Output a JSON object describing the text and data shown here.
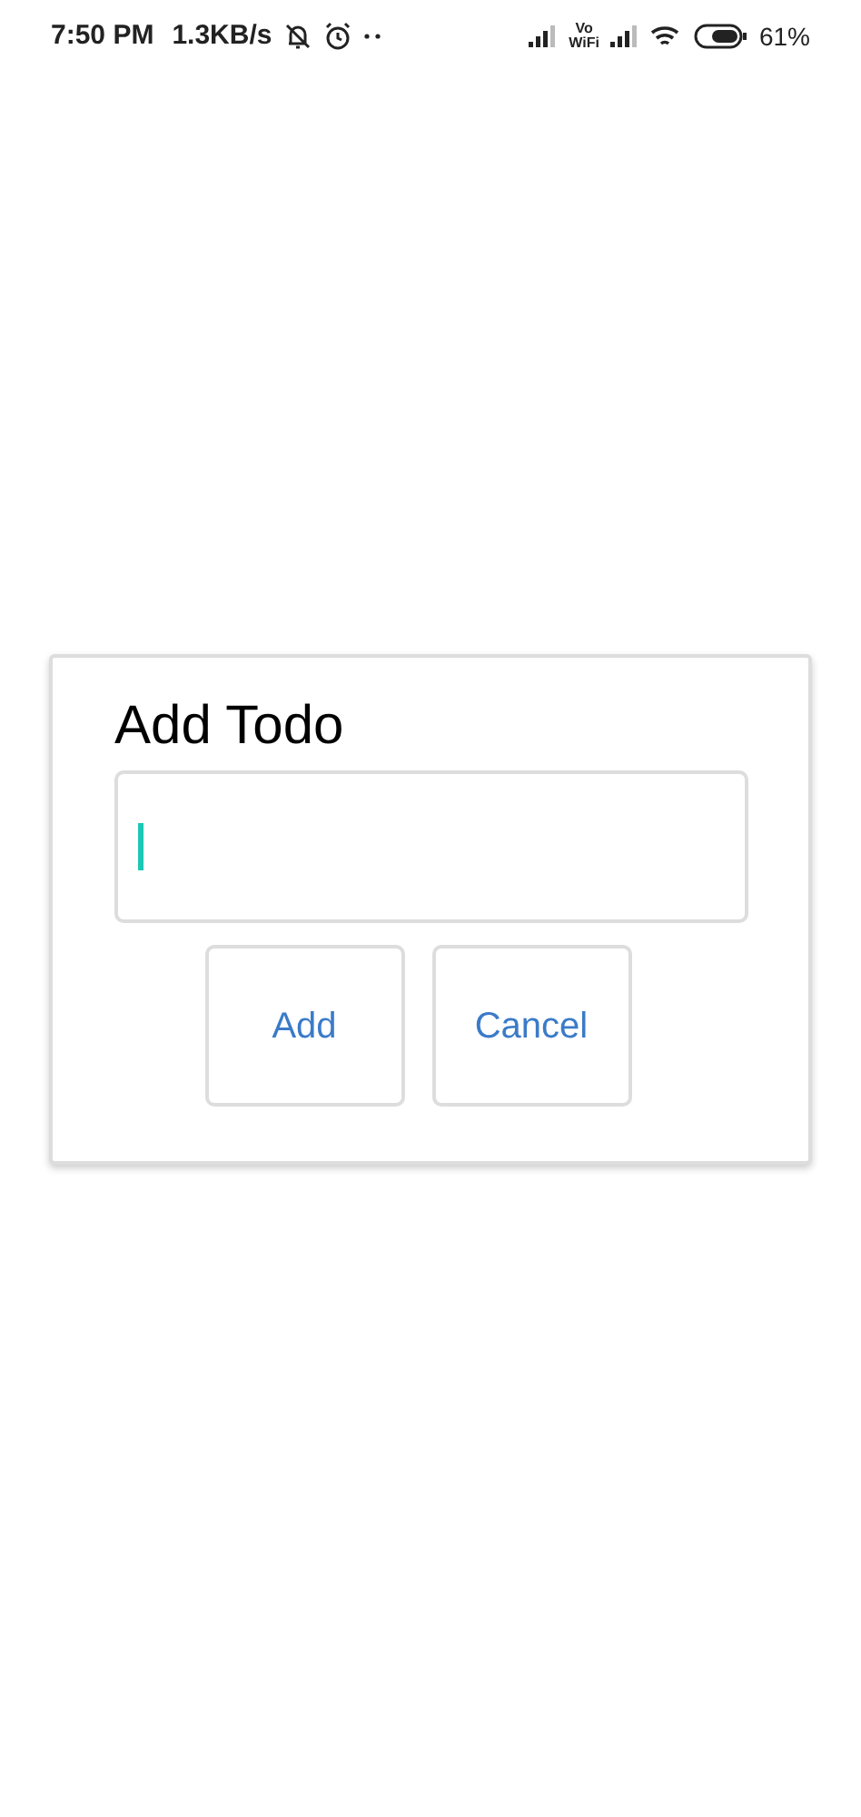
{
  "status_bar": {
    "time": "7:50 PM",
    "speed": "1.3KB/s",
    "volte_top": "Vo",
    "volte_bottom": "WiFi",
    "battery": "61%"
  },
  "dialog": {
    "title": "Add Todo",
    "field": {
      "focused": true
    },
    "buttons": [
      "Add",
      "Cancel"
    ]
  }
}
